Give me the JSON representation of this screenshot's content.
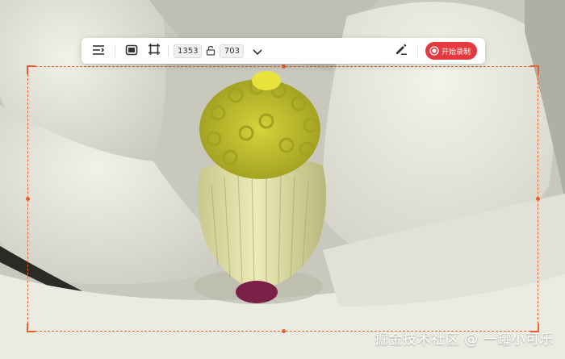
{
  "toolbar": {
    "width_value": "1353",
    "height_value": "703",
    "record_label": "开始录制",
    "icons": [
      "align-right-icon",
      "screen-icon",
      "crop-region-icon",
      "lock-icon",
      "chevron-down-icon",
      "pen-icon",
      "record-icon"
    ]
  },
  "colors": {
    "selection": "#e8602c",
    "record_button": "#e5393f",
    "toolbar_bg": "#ffffff"
  },
  "watermark": {
    "text": "掘金技术社区 @ 一罐小可乐"
  }
}
